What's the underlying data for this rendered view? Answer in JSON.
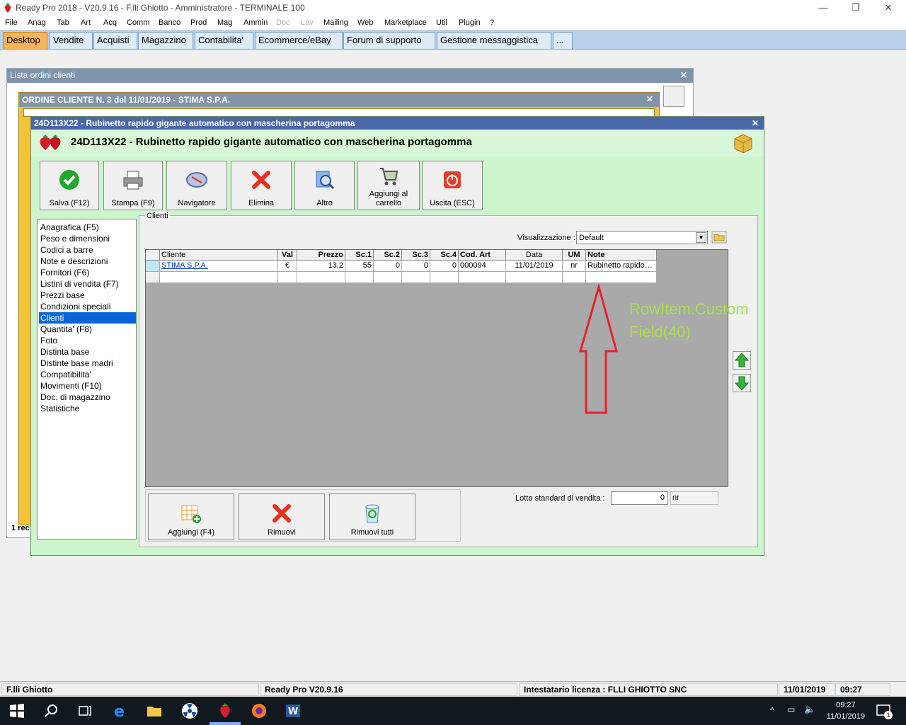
{
  "window": {
    "title": "Ready Pro 2018 - V20.9.16 - F.lli Ghiotto - Amministratore - TERMINALE 100",
    "minimize": "—",
    "maximize": "❐",
    "close": "✕"
  },
  "menu": [
    "File",
    "Anag",
    "Tab",
    "Art",
    "Acq",
    "Comm",
    "Banco",
    "Prod",
    "Mag",
    "Ammin",
    "Doc",
    "Lav",
    "Mailing",
    "Web",
    "Marketplace",
    "Util",
    "Plugin",
    "?"
  ],
  "tabs": [
    "Desktop",
    "Vendite",
    "Acquisti",
    "Magazzino",
    "Contabilita'",
    "Ecommerce/eBay",
    "Forum di supporto",
    "Gestione messaggistica",
    "..."
  ],
  "bg_windows": {
    "lista_title": "Lista ordini clienti",
    "ordine_title": "ORDINE CLIENTE N. 3 del 11/01/2019 - STIMA S.P.A.",
    "records": "1 rec"
  },
  "main": {
    "title_bar": "24D113X22 - Rubinetto rapido gigante automatico con mascherina portagomma",
    "header_title": "24D113X22 - Rubinetto rapido gigante automatico con mascherina portagomma",
    "close": "✕",
    "toolbar": [
      {
        "label": "Salva (F12)",
        "icon": "check-icon",
        "color": "#1faa2a"
      },
      {
        "label": "Stampa (F9)",
        "icon": "printer-icon",
        "color": "#777777"
      },
      {
        "label": "Navigatore",
        "icon": "compass-icon",
        "color": "#5a6ea8"
      },
      {
        "label": "Elimina",
        "icon": "x-icon",
        "color": "#e83020"
      },
      {
        "label": "Altro",
        "icon": "magnifier-icon",
        "color": "#3a7ad8"
      },
      {
        "label": "Aggiungi al carrello",
        "icon": "cart-icon",
        "color": "#6a8aa0"
      },
      {
        "label": "Uscita (ESC)",
        "icon": "power-icon",
        "color": "#e04030"
      }
    ],
    "left_menu": [
      "Anagrafica (F5)",
      "Peso e dimensioni",
      "Codici a barre",
      "Note e descrizioni",
      "Fornitori (F6)",
      "Listini di vendita (F7)",
      "Prezzi base",
      "Condizioni speciali",
      "Clienti",
      "Quantita' (F8)",
      "Foto",
      "Distinta base",
      "Distinte base madri",
      "Compatibilita'",
      "Movimenti (F10)",
      "Doc. di magazzino",
      "Statistiche"
    ],
    "left_menu_selected": 8,
    "panel_label": "Clienti",
    "visualizzazione_label": "Visualizzazione :",
    "visualizzazione_value": "Default",
    "grid": {
      "headers": [
        "Cliente",
        "Val",
        "Prezzo",
        "Sc.1",
        "Sc.2",
        "Sc.3",
        "Sc.4",
        "Cod. Art",
        "Data",
        "UM",
        "Note"
      ],
      "rows": [
        [
          "STIMA S.P.A.",
          "€",
          "13,2",
          "55",
          "0",
          "0",
          "0",
          "000094",
          "11/01/2019",
          "nr",
          "Rubinetto rapido…"
        ]
      ]
    },
    "annotation": "RowItem.CustomField(40)",
    "bottom_buttons": [
      {
        "label": "Aggiungi (F4)",
        "icon": "grid-add-icon"
      },
      {
        "label": "Rimuovi",
        "icon": "x-icon"
      },
      {
        "label": "Rimuovi tutti",
        "icon": "recycle-bin-icon"
      }
    ],
    "lotto_label": "Lotto standard di vendita :",
    "lotto_value": "0",
    "lotto_unit": "nr"
  },
  "statusbar": [
    "F.lli Ghiotto",
    "Ready Pro V20.9.16",
    "Intestatario licenza : FLLI GHIOTTO SNC",
    "11/01/2019",
    "09:27"
  ],
  "taskbar": {
    "time": "09:27",
    "date": "11/01/2019",
    "notifications": "1"
  }
}
